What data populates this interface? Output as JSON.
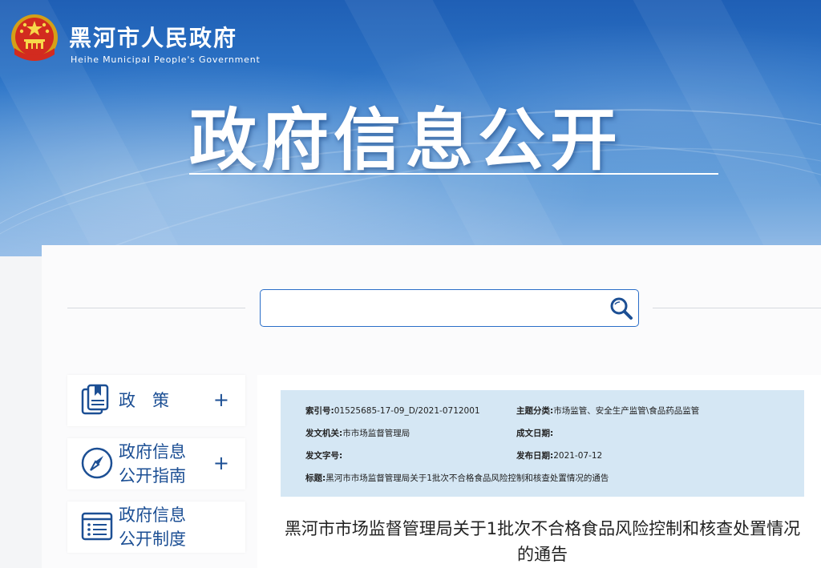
{
  "site": {
    "name_cn": "黑河市人民政府",
    "name_en": "Heihe Municipal People's Government",
    "emblem_icon": "national-emblem-icon"
  },
  "banner": {
    "title": "政府信息公开"
  },
  "search": {
    "value": "",
    "placeholder": "",
    "button_icon": "search-icon"
  },
  "sidebar": {
    "items": [
      {
        "label": "政　策",
        "icon": "document-stack-icon",
        "expand": "+"
      },
      {
        "label": "政府信息\n公开指南",
        "icon": "compass-icon",
        "expand": "+"
      },
      {
        "label": "政府信息\n公开制度",
        "icon": "list-doc-icon",
        "expand": ""
      }
    ]
  },
  "meta": {
    "index_label": "索引号:",
    "index_value": "01525685-17-09_D/2021-0712001",
    "topic_label": "主题分类:",
    "topic_value": "市场监管、安全生产监管\\食品药品监管",
    "issuer_label": "发文机关:",
    "issuer_value": "市市场监督管理局",
    "created_label": "成文日期:",
    "created_value": "",
    "docno_label": "发文字号:",
    "docno_value": "",
    "published_label": "发布日期:",
    "published_value": "2021-07-12",
    "title_label": "标题:",
    "title_value": "黑河市市场监督管理局关于1批次不合格食品风险控制和核查处置情况的通告"
  },
  "article": {
    "title": "黑河市市场监督管理局关于1批次不合格食品风险控制和核查处置情况的通告"
  },
  "colors": {
    "brand_blue": "#1c4f94",
    "meta_bg": "#d5e7f4",
    "search_border": "#2a6ec8"
  }
}
